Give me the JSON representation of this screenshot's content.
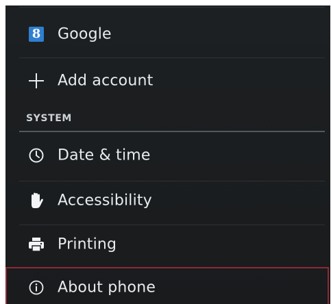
{
  "accounts": {
    "google": {
      "label": "Google",
      "icon": "google-plus-icon",
      "badge_text": "8",
      "badge_color": "#2f7fd1"
    },
    "add_account": {
      "label": "Add account",
      "icon": "plus-icon"
    }
  },
  "system": {
    "header": "SYSTEM",
    "items": [
      {
        "label": "Date & time",
        "icon": "clock-icon"
      },
      {
        "label": "Accessibility",
        "icon": "hand-icon"
      },
      {
        "label": "Printing",
        "icon": "printer-icon"
      },
      {
        "label": "About phone",
        "icon": "info-icon"
      }
    ]
  },
  "colors": {
    "background": "#1b1e20",
    "text": "#e9ecee",
    "highlight_border": "#8d2a33"
  }
}
